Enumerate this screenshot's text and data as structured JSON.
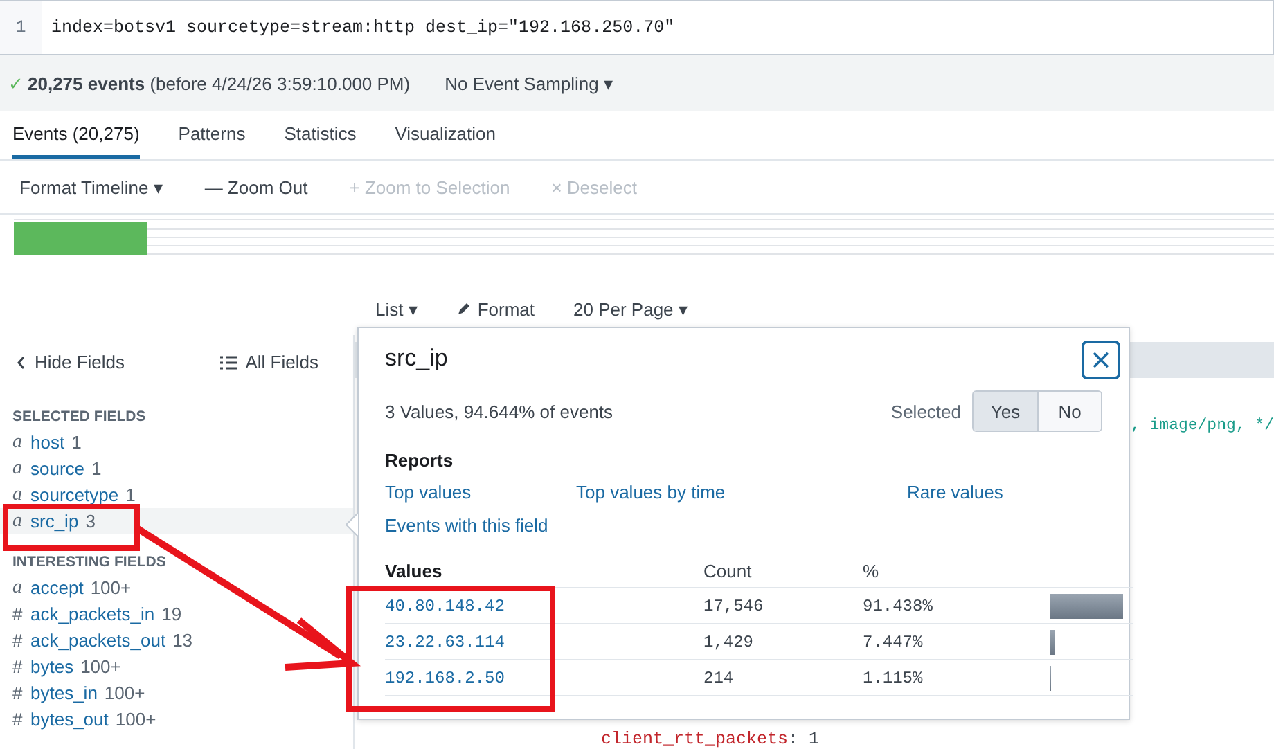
{
  "search": {
    "line_number": "1",
    "query": "index=botsv1 sourcetype=stream:http dest_ip=\"192.168.250.70\""
  },
  "status": {
    "check": "✓",
    "summary": "**20,275 events** (before 4/24/26 3:59:10.000 PM)",
    "sampling": "No Event Sampling",
    "sampling_caret": "▾"
  },
  "tabs": [
    {
      "label": "Events (20,275)",
      "selected": true
    },
    {
      "label": "Patterns",
      "selected": false
    },
    {
      "label": "Statistics",
      "selected": false
    },
    {
      "label": "Visualization",
      "selected": false
    }
  ],
  "timeline_toolbar": [
    {
      "label": "Format Timeline",
      "suffix": "▾",
      "disabled": false
    },
    {
      "prefix": "—",
      "label": "Zoom Out",
      "disabled": false
    },
    {
      "prefix": "+",
      "label": "Zoom to Selection",
      "disabled": true
    },
    {
      "prefix": "×",
      "label": "Deselect",
      "disabled": true
    }
  ],
  "results_toolbar": [
    {
      "kind": "dropdown",
      "label": "List",
      "caret": "▾"
    },
    {
      "kind": "edit",
      "label": "Format"
    },
    {
      "kind": "dropdown",
      "label": "20 Per Page",
      "caret": "▾"
    }
  ],
  "sidebar": {
    "hide_label": "Hide Fields",
    "all_label": "All Fields",
    "sections": [
      {
        "title": "SELECTED FIELDS",
        "fields": [
          {
            "type": "a",
            "name": "host",
            "count": "1",
            "selected": false
          },
          {
            "type": "a",
            "name": "source",
            "count": "1",
            "selected": false
          },
          {
            "type": "a",
            "name": "sourcetype",
            "count": "1",
            "selected": false
          },
          {
            "type": "a",
            "name": "src_ip",
            "count": "3",
            "selected": true
          }
        ]
      },
      {
        "title": "INTERESTING FIELDS",
        "fields": [
          {
            "type": "a",
            "name": "accept",
            "count": "100+",
            "selected": false
          },
          {
            "type": "#",
            "name": "ack_packets_in",
            "count": "19",
            "selected": false
          },
          {
            "type": "#",
            "name": "ack_packets_out",
            "count": "13",
            "selected": false
          },
          {
            "type": "#",
            "name": "bytes",
            "count": "100+",
            "selected": false
          },
          {
            "type": "#",
            "name": "bytes_in",
            "count": "100+",
            "selected": false
          },
          {
            "type": "#",
            "name": "bytes_out",
            "count": "100+",
            "selected": false
          }
        ]
      }
    ]
  },
  "events": {
    "fragment": ", image/png, */",
    "field_key": "client_rtt_packets",
    "separator": ":",
    "field_value": "1"
  },
  "popup": {
    "title": "src_ip",
    "summary": "3 Values, 94.644% of events",
    "selected_label": "Selected",
    "toggle": [
      {
        "label": "Yes",
        "selected": true
      },
      {
        "label": "No",
        "selected": false
      }
    ],
    "reports_title": "Reports",
    "reports": [
      "Top values",
      "Top values by time",
      "Rare values",
      "Events with this field"
    ],
    "columns": [
      "Values",
      "Count",
      "%"
    ],
    "rows": [
      {
        "value": "40.80.148.42",
        "count": "17,546",
        "percent": "91.438%",
        "level": 0.914
      },
      {
        "value": "23.22.63.114",
        "count": "1,429",
        "percent": "7.447%",
        "level": 0.074
      },
      {
        "value": "192.168.2.50",
        "count": "214",
        "percent": "1.115%",
        "level": 0.011
      }
    ]
  }
}
